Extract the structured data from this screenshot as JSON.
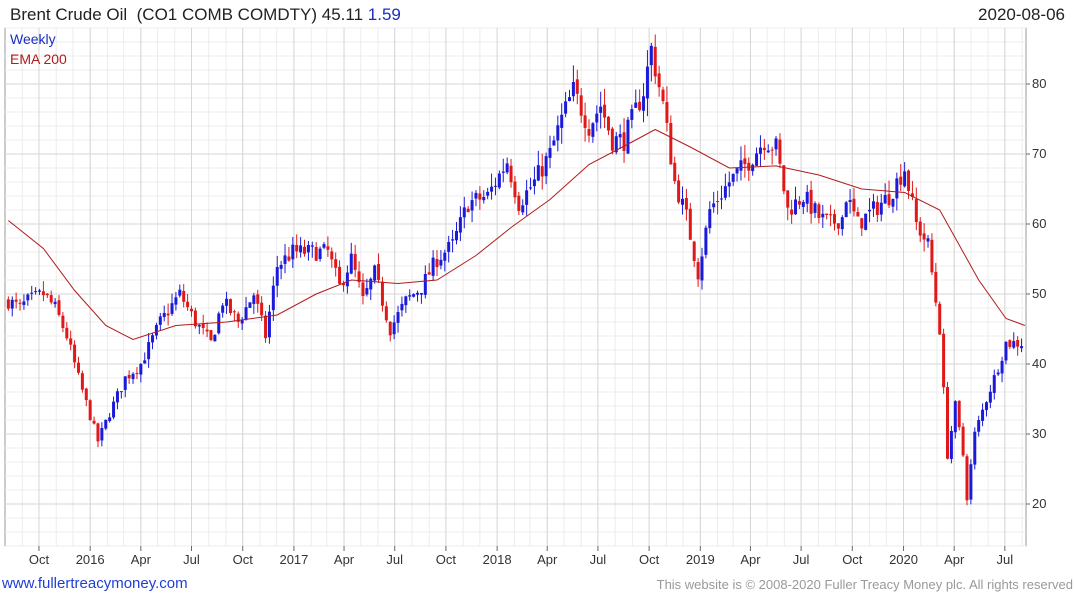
{
  "header": {
    "name": "Brent Crude Oil",
    "ticker": "(CO1 COMB COMDTY)",
    "last": "45.11",
    "change": "1.59",
    "date": "2020-08-06"
  },
  "legend": {
    "period": "Weekly",
    "ema": "EMA 200"
  },
  "footer": {
    "link": "www.fullertreacymoney.com",
    "copyright": "This website is © 2008-2020 Fuller Treacy Money plc. All rights reserved"
  },
  "colors": {
    "up": "#1a1adb",
    "down": "#e01818",
    "ema": "#b01c1c",
    "grid": "#d6d6d6"
  },
  "chart_data": {
    "type": "candlestick",
    "frequency": "weekly",
    "ylim": [
      14,
      88
    ],
    "yticks": [
      20,
      30,
      40,
      50,
      60,
      70,
      80
    ],
    "xrange": [
      "2015-08-01",
      "2020-08-08"
    ],
    "xticks": [
      {
        "date": "2015-10-01",
        "label": "Oct"
      },
      {
        "date": "2016-01-01",
        "label": "2016"
      },
      {
        "date": "2016-04-01",
        "label": "Apr"
      },
      {
        "date": "2016-07-01",
        "label": "Jul"
      },
      {
        "date": "2016-10-01",
        "label": "Oct"
      },
      {
        "date": "2017-01-01",
        "label": "2017"
      },
      {
        "date": "2017-04-01",
        "label": "Apr"
      },
      {
        "date": "2017-07-01",
        "label": "Jul"
      },
      {
        "date": "2017-10-01",
        "label": "Oct"
      },
      {
        "date": "2018-01-01",
        "label": "2018"
      },
      {
        "date": "2018-04-01",
        "label": "Apr"
      },
      {
        "date": "2018-07-01",
        "label": "Jul"
      },
      {
        "date": "2018-10-01",
        "label": "Oct"
      },
      {
        "date": "2019-01-01",
        "label": "2019"
      },
      {
        "date": "2019-04-01",
        "label": "Apr"
      },
      {
        "date": "2019-07-01",
        "label": "Jul"
      },
      {
        "date": "2019-10-01",
        "label": "Oct"
      },
      {
        "date": "2020-01-01",
        "label": "2020"
      },
      {
        "date": "2020-04-01",
        "label": "Apr"
      },
      {
        "date": "2020-07-01",
        "label": "Jul"
      }
    ],
    "price_path": [
      [
        "2015-08-07",
        49
      ],
      [
        "2015-08-28",
        48
      ],
      [
        "2015-09-11",
        49
      ],
      [
        "2015-10-09",
        50
      ],
      [
        "2015-10-30",
        48
      ],
      [
        "2015-11-20",
        44
      ],
      [
        "2015-12-11",
        38
      ],
      [
        "2016-01-15",
        29
      ],
      [
        "2016-02-05",
        33
      ],
      [
        "2016-03-04",
        38
      ],
      [
        "2016-04-01",
        40
      ],
      [
        "2016-05-06",
        46
      ],
      [
        "2016-06-10",
        50
      ],
      [
        "2016-07-08",
        46
      ],
      [
        "2016-08-05",
        43
      ],
      [
        "2016-08-26",
        49
      ],
      [
        "2016-09-23",
        46
      ],
      [
        "2016-10-21",
        50
      ],
      [
        "2016-11-11",
        44
      ],
      [
        "2016-12-02",
        54
      ],
      [
        "2016-12-30",
        56
      ],
      [
        "2017-02-03",
        56
      ],
      [
        "2017-03-03",
        56
      ],
      [
        "2017-03-24",
        51
      ],
      [
        "2017-04-14",
        55
      ],
      [
        "2017-05-05",
        49
      ],
      [
        "2017-05-26",
        53
      ],
      [
        "2017-06-23",
        45
      ],
      [
        "2017-07-21",
        49
      ],
      [
        "2017-08-18",
        51
      ],
      [
        "2017-09-15",
        55
      ],
      [
        "2017-10-13",
        57
      ],
      [
        "2017-11-10",
        63
      ],
      [
        "2017-12-15",
        64
      ],
      [
        "2018-01-19",
        69
      ],
      [
        "2018-02-09",
        63
      ],
      [
        "2018-03-09",
        66
      ],
      [
        "2018-04-06",
        70
      ],
      [
        "2018-04-27",
        75
      ],
      [
        "2018-05-18",
        79
      ],
      [
        "2018-06-15",
        74
      ],
      [
        "2018-07-06",
        77
      ],
      [
        "2018-07-27",
        72
      ],
      [
        "2018-08-17",
        72
      ],
      [
        "2018-09-21",
        79
      ],
      [
        "2018-10-05",
        85
      ],
      [
        "2018-10-26",
        77
      ],
      [
        "2018-11-16",
        66
      ],
      [
        "2018-12-07",
        61
      ],
      [
        "2018-12-28",
        53
      ],
      [
        "2019-01-18",
        62
      ],
      [
        "2019-02-22",
        66
      ],
      [
        "2019-03-29",
        69
      ],
      [
        "2019-04-26",
        72
      ],
      [
        "2019-05-17",
        71
      ],
      [
        "2019-06-07",
        62
      ],
      [
        "2019-07-05",
        64
      ],
      [
        "2019-08-02",
        61
      ],
      [
        "2019-08-23",
        60
      ],
      [
        "2019-09-13",
        61
      ],
      [
        "2019-09-20",
        64
      ],
      [
        "2019-10-11",
        60
      ],
      [
        "2019-11-08",
        62
      ],
      [
        "2019-12-06",
        64
      ],
      [
        "2020-01-03",
        68
      ],
      [
        "2020-01-24",
        60
      ],
      [
        "2020-02-14",
        57
      ],
      [
        "2020-03-06",
        45
      ],
      [
        "2020-03-20",
        27
      ],
      [
        "2020-04-03",
        34
      ],
      [
        "2020-04-17",
        27
      ],
      [
        "2020-04-24",
        21
      ],
      [
        "2020-05-08",
        30
      ],
      [
        "2020-05-29",
        35
      ],
      [
        "2020-06-12",
        38
      ],
      [
        "2020-07-03",
        43
      ],
      [
        "2020-07-31",
        43
      ],
      [
        "2020-08-06",
        45.11
      ]
    ],
    "ema200": [
      [
        "2015-08-07",
        60.5
      ],
      [
        "2015-10-09",
        56.5
      ],
      [
        "2015-12-04",
        50.5
      ],
      [
        "2016-01-29",
        45.5
      ],
      [
        "2016-03-18",
        43.5
      ],
      [
        "2016-06-03",
        45.5
      ],
      [
        "2016-09-02",
        46.0
      ],
      [
        "2016-12-02",
        47.0
      ],
      [
        "2017-02-10",
        50.0
      ],
      [
        "2017-04-14",
        52.0
      ],
      [
        "2017-07-07",
        51.5
      ],
      [
        "2017-09-15",
        52.0
      ],
      [
        "2017-11-24",
        55.5
      ],
      [
        "2018-01-26",
        59.5
      ],
      [
        "2018-04-06",
        63.5
      ],
      [
        "2018-06-15",
        68.5
      ],
      [
        "2018-09-07",
        72.0
      ],
      [
        "2018-10-12",
        73.5
      ],
      [
        "2018-12-14",
        71.0
      ],
      [
        "2019-02-22",
        68.0
      ],
      [
        "2019-05-17",
        68.3
      ],
      [
        "2019-08-02",
        67.0
      ],
      [
        "2019-10-18",
        65.0
      ],
      [
        "2020-01-03",
        64.5
      ],
      [
        "2020-03-06",
        62.0
      ],
      [
        "2020-05-15",
        52.0
      ],
      [
        "2020-07-03",
        46.5
      ],
      [
        "2020-08-06",
        45.5
      ]
    ]
  }
}
